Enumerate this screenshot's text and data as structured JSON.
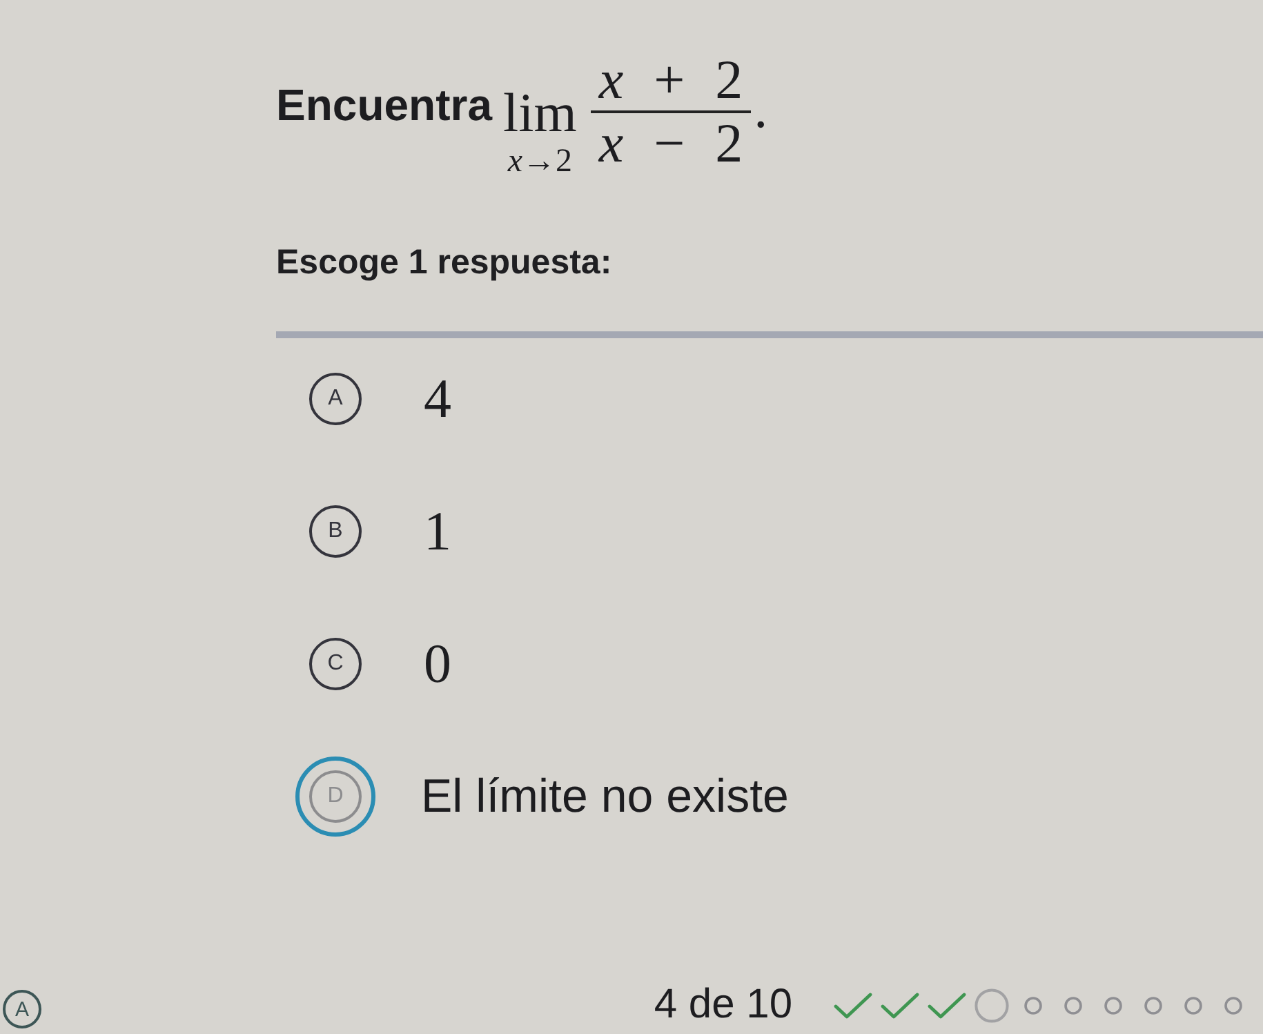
{
  "question": {
    "prompt": "Encuentra",
    "formula": {
      "operator": "lim",
      "under": "*x*→2",
      "numerator": "*x* + 2",
      "denominator": "*x* − 2",
      "end": "."
    }
  },
  "instruction": "Escoge 1 respuesta:",
  "choices": [
    {
      "letter": "A",
      "kind": "math",
      "text": "4",
      "selected": false
    },
    {
      "letter": "B",
      "kind": "math",
      "text": "1",
      "selected": false
    },
    {
      "letter": "C",
      "kind": "math",
      "text": "0",
      "selected": false
    },
    {
      "letter": "D",
      "kind": "text",
      "text": "El límite no existe",
      "selected": true
    }
  ],
  "footer": {
    "badge": "A",
    "counter": "4 de 10",
    "steps": [
      {
        "kind": "done"
      },
      {
        "kind": "done"
      },
      {
        "kind": "done"
      },
      {
        "kind": "current"
      },
      {
        "kind": "pending"
      },
      {
        "kind": "pending"
      },
      {
        "kind": "pending"
      },
      {
        "kind": "pending"
      },
      {
        "kind": "pending"
      },
      {
        "kind": "pending"
      }
    ]
  }
}
